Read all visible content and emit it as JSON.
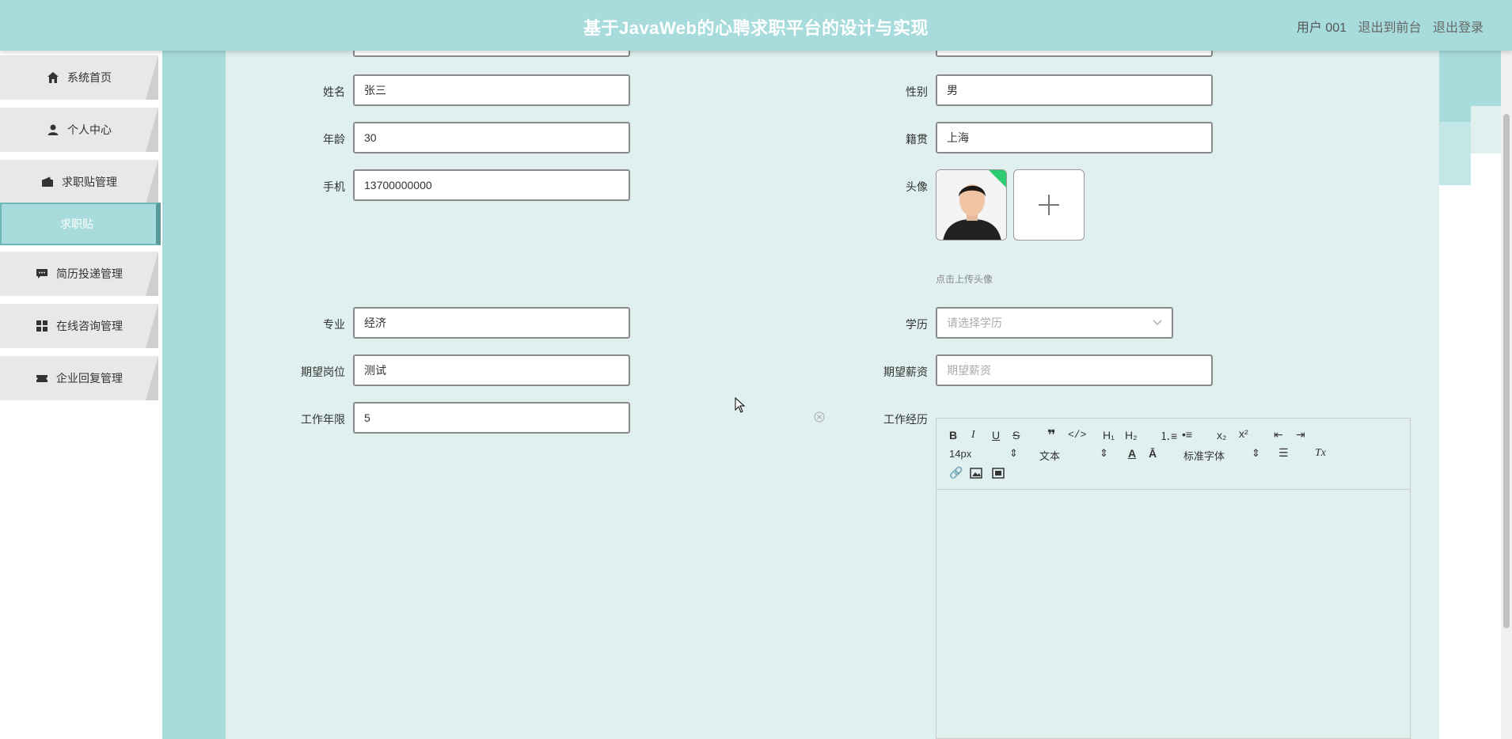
{
  "header": {
    "title": "基于JavaWeb的心聘求职平台的设计与实现",
    "user": "用户 001",
    "to_front": "退出到前台",
    "logout": "退出登录"
  },
  "sidebar": {
    "items": [
      {
        "label": "系统首页",
        "icon": "home-icon"
      },
      {
        "label": "个人中心",
        "icon": "user-icon"
      },
      {
        "label": "求职贴管理",
        "icon": "wallet-icon"
      },
      {
        "label": "简历投递管理",
        "icon": "chat-icon"
      },
      {
        "label": "在线咨询管理",
        "icon": "grid-icon"
      },
      {
        "label": "企业回复管理",
        "icon": "ticket-icon"
      }
    ],
    "active_sub": "求职贴"
  },
  "form": {
    "name_label": "姓名",
    "name_value": "张三",
    "gender_label": "性别",
    "gender_value": "男",
    "age_label": "年龄",
    "age_value": "30",
    "origin_label": "籍贯",
    "origin_value": "上海",
    "phone_label": "手机",
    "phone_value": "13700000000",
    "avatar_label": "头像",
    "avatar_hint": "点击上传头像",
    "major_label": "专业",
    "major_value": "经济",
    "edu_label": "学历",
    "edu_placeholder": "请选择学历",
    "position_label": "期望岗位",
    "position_value": "测试",
    "salary_label": "期望薪资",
    "salary_placeholder": "期望薪资",
    "years_label": "工作年限",
    "years_value": "5",
    "experience_label": "工作经历"
  },
  "editor": {
    "font_size": "14px",
    "text_style": "文本",
    "font_family": "标准字体"
  },
  "colors": {
    "accent": "#a8dcdc",
    "content_bg": "#dff0ef"
  }
}
